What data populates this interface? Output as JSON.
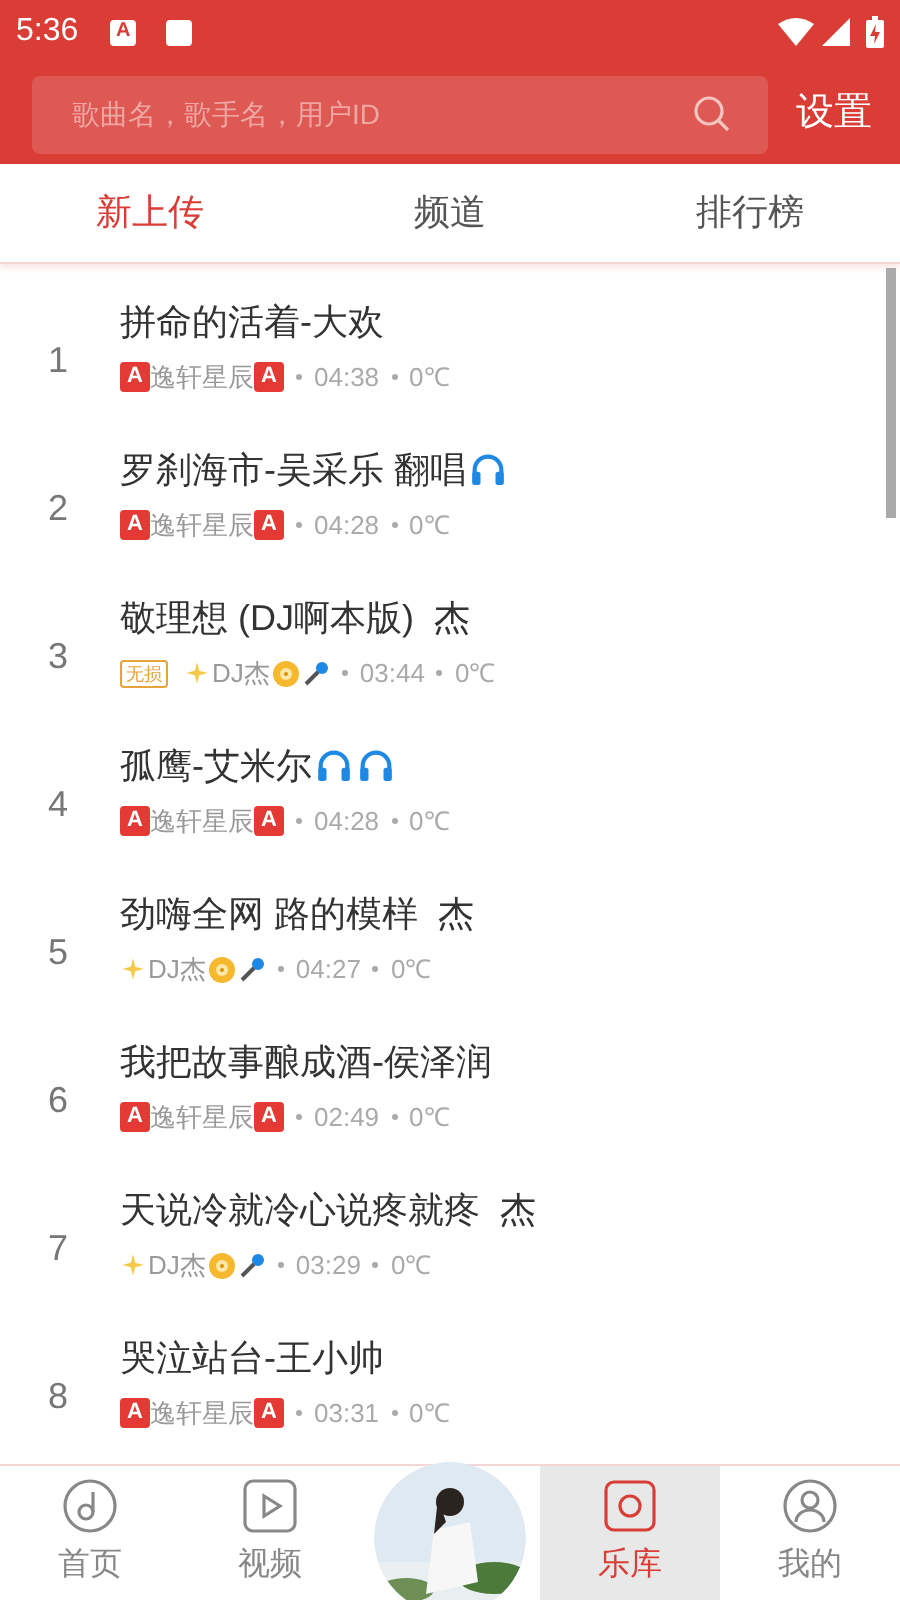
{
  "status_bar": {
    "time": "5:36",
    "badge": "A"
  },
  "search": {
    "placeholder": "歌曲名，歌手名，用户ID"
  },
  "settings_label": "设置",
  "tabs": [
    {
      "label": "新上传",
      "selected": true
    },
    {
      "label": "频道",
      "selected": false
    },
    {
      "label": "排行榜",
      "selected": false
    }
  ],
  "songs": [
    {
      "index": "1",
      "title": "拼命的活着-大欢",
      "author": {
        "kind": "badge",
        "name": "逸轩星辰",
        "badge_left": "A",
        "badge_right": "A"
      },
      "duration": "04:38",
      "temp": "0℃"
    },
    {
      "index": "2",
      "title": "罗刹海市-吴采乐 翻唱",
      "decorations": [
        {
          "kind": "headphones"
        }
      ],
      "author": {
        "kind": "badge",
        "name": "逸轩星辰",
        "badge_left": "A",
        "badge_right": "A"
      },
      "duration": "04:28",
      "temp": "0℃"
    },
    {
      "index": "3",
      "title": "敬理想 (DJ啊本版)  杰",
      "tag": "无损",
      "author": {
        "kind": "dj",
        "name": "DJ杰"
      },
      "duration": "03:44",
      "temp": "0℃"
    },
    {
      "index": "4",
      "title": "孤鹰-艾米尔",
      "decorations": [
        {
          "kind": "headphones"
        },
        {
          "kind": "headphones"
        }
      ],
      "author": {
        "kind": "badge",
        "name": "逸轩星辰",
        "badge_left": "A",
        "badge_right": "A"
      },
      "duration": "04:28",
      "temp": "0℃"
    },
    {
      "index": "5",
      "title": "劲嗨全网 路的模样  杰",
      "author": {
        "kind": "dj",
        "name": "DJ杰"
      },
      "duration": "04:27",
      "temp": "0℃"
    },
    {
      "index": "6",
      "title": "我把故事酿成酒-侯泽润",
      "author": {
        "kind": "badge",
        "name": "逸轩星辰",
        "badge_left": "A",
        "badge_right": "A"
      },
      "duration": "02:49",
      "temp": "0℃"
    },
    {
      "index": "7",
      "title": "天说冷就冷心说疼就疼  杰",
      "author": {
        "kind": "dj",
        "name": "DJ杰"
      },
      "duration": "03:29",
      "temp": "0℃"
    },
    {
      "index": "8",
      "title": "哭泣站台-王小帅",
      "author": {
        "kind": "badge",
        "name": "逸轩星辰",
        "badge_left": "A",
        "badge_right": "A"
      },
      "duration": "03:31",
      "temp": "0℃"
    }
  ],
  "nav": [
    {
      "kind": "home",
      "label": "首页",
      "selected": false
    },
    {
      "kind": "video",
      "label": "视频",
      "selected": false
    },
    {
      "kind": "player"
    },
    {
      "kind": "library",
      "label": "乐库",
      "selected": true
    },
    {
      "kind": "mine",
      "label": "我的",
      "selected": false
    }
  ]
}
